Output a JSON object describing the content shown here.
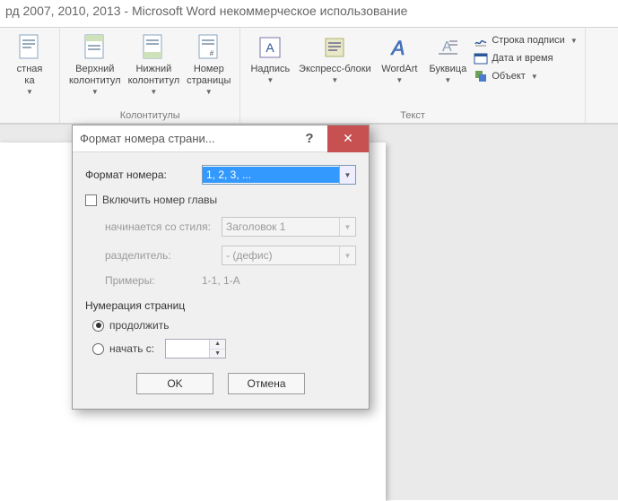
{
  "window_title": "рд 2007, 2010, 2013  -  Microsoft Word некоммерческое использование",
  "ribbon": {
    "fragment_btn": "стная\nка",
    "header": "Верхний\nколонтитул",
    "footer": "Нижний\nколонтитул",
    "page_number": "Номер\nстраницы",
    "group_headerfooter": "Колонтитулы",
    "textbox": "Надпись",
    "quickparts": "Экспресс-блоки",
    "wordart": "WordArt",
    "dropcap": "Буквица",
    "group_text": "Текст",
    "signature_line": "Строка подписи",
    "date_time": "Дата и время",
    "object": "Объект"
  },
  "dialog": {
    "title": "Формат номера страни...",
    "format_label": "Формат номера:",
    "format_value": "1, 2, 3, ...",
    "include_chapter": "Включить номер главы",
    "starts_with_style": "начинается со стиля:",
    "style_value": "Заголовок 1",
    "separator_label": "разделитель:",
    "separator_value": "-   (дефис)",
    "examples_label": "Примеры:",
    "examples_value": "1-1, 1-A",
    "numbering_section": "Нумерация страниц",
    "continue": "продолжить",
    "start_at": "начать с:",
    "start_value": "",
    "ok": "OK",
    "cancel": "Отмена"
  }
}
